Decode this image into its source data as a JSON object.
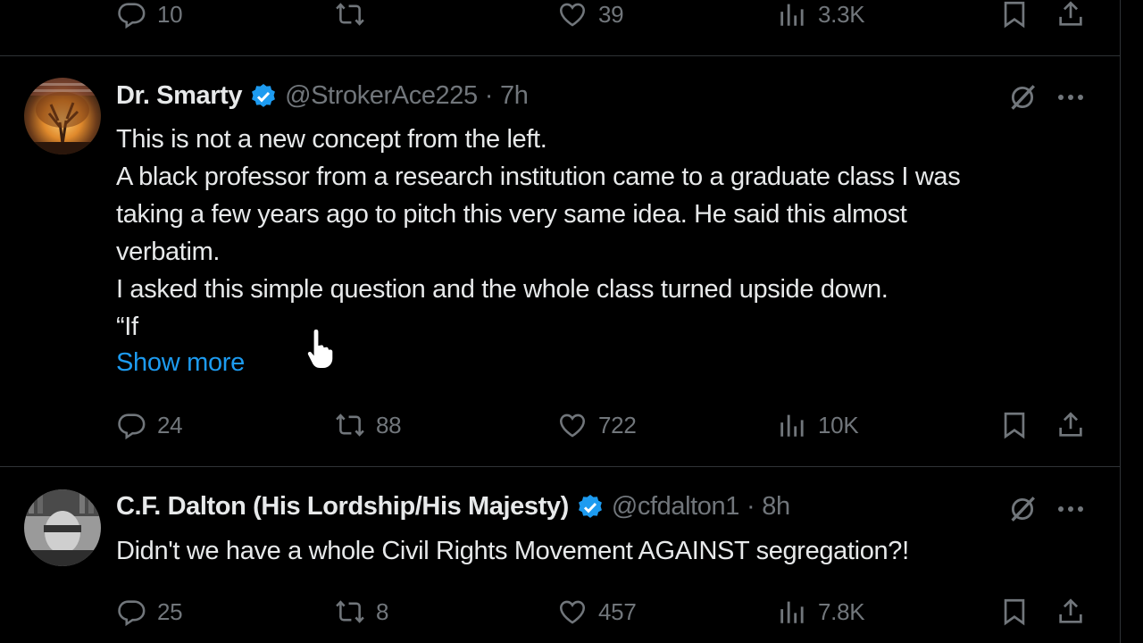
{
  "top_actions": {
    "replies": "10",
    "retweets": "",
    "likes": "39",
    "views": "3.3K"
  },
  "tweets": [
    {
      "name": "Dr. Smarty",
      "handle": "@StrokerAce225",
      "separator": "·",
      "time": "7h",
      "lines": [
        "This is not a new concept from the left.",
        "A black professor from a research institution came to a graduate class I was",
        "taking a few years ago to pitch this very same idea. He said this almost",
        "verbatim.",
        "I asked this simple question and the whole class turned upside down.",
        "“If"
      ],
      "show_more": "Show more",
      "actions": {
        "replies": "24",
        "retweets": "88",
        "likes": "722",
        "views": "10K"
      }
    },
    {
      "name": "C.F. Dalton (His Lordship/His Majesty)",
      "handle": "@cfdalton1",
      "separator": "·",
      "time": "8h",
      "lines": [
        "Didn't we have a whole Civil Rights Movement AGAINST segregation?!"
      ],
      "actions": {
        "replies": "25",
        "retweets": "8",
        "likes": "457",
        "views": "7.8K"
      }
    }
  ],
  "colors": {
    "background": "#000000",
    "text": "#e7e9ea",
    "muted": "#71767b",
    "accent": "#1d9bf0",
    "border": "#2f3336"
  },
  "icons": [
    "reply-icon",
    "retweet-icon",
    "like-icon",
    "views-icon",
    "bookmark-icon",
    "share-icon",
    "verified-badge-icon",
    "grok-icon",
    "more-icon",
    "hand-cursor-icon"
  ]
}
